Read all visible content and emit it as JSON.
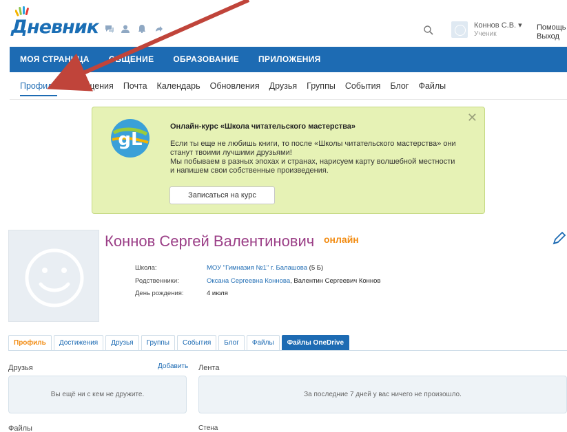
{
  "header": {
    "logo": "Дневник",
    "icons": [
      "chat-icon",
      "person-icon",
      "bell-icon",
      "share-icon"
    ],
    "user_name": "Коннов С.В. ▾",
    "user_role": "Ученик",
    "help": "Помощь",
    "exit": "Выход"
  },
  "mainnav": {
    "items": [
      "МОЯ СТРАНИЦА",
      "ОБЩЕНИЕ",
      "ОБРАЗОВАНИЕ",
      "ПРИЛОЖЕНИЯ"
    ]
  },
  "subnav": {
    "items": [
      "Профиль",
      "Сообщения",
      "Почта",
      "Календарь",
      "Обновления",
      "Друзья",
      "Группы",
      "События",
      "Блог",
      "Файлы"
    ]
  },
  "promo": {
    "title": "Онлайн-курс «Школа читательского мастерства»",
    "body1": "Если ты еще не любишь книги, то после «Школы читательского мастерства» они станут твоими лучшими друзьями!",
    "body2": "Мы побываем в разных эпохах и странах, нарисуем карту волшебной местности и напишем свои собственные произведения.",
    "button": "Записаться на курс",
    "close": "✕",
    "logo_text": "gL"
  },
  "profile": {
    "name": "Коннов Сергей Валентинович",
    "status": "онлайн",
    "school_label": "Школа:",
    "school_value": "МОУ \"Гимназия №1\" г. Балашова",
    "school_class": " (5 Б)",
    "relatives_label": "Родственники:",
    "relative1": "Оксана Сергеевна Коннова",
    "relative_sep": ", ",
    "relative2": "Валентин Сергеевич Коннов",
    "birthday_label": "День рождения:",
    "birthday_value": "4 июля"
  },
  "tabs": [
    "Профиль",
    "Достижения",
    "Друзья",
    "Группы",
    "События",
    "Блог",
    "Файлы",
    "Файлы OneDrive"
  ],
  "friends": {
    "title": "Друзья",
    "add": "Добавить",
    "empty": "Вы ещё ни с кем не дружите."
  },
  "feed": {
    "title": "Лента",
    "empty": "За последние 7 дней у вас ничего не произошло."
  },
  "files": {
    "title": "Файлы"
  },
  "wall": {
    "title": "Стена"
  },
  "colors": {
    "brand": "#1d6bb3",
    "profile_name": "#9b3f87",
    "online": "#f28c13",
    "promo_bg": "#e6f2b5",
    "arrow": "#c0443a"
  }
}
